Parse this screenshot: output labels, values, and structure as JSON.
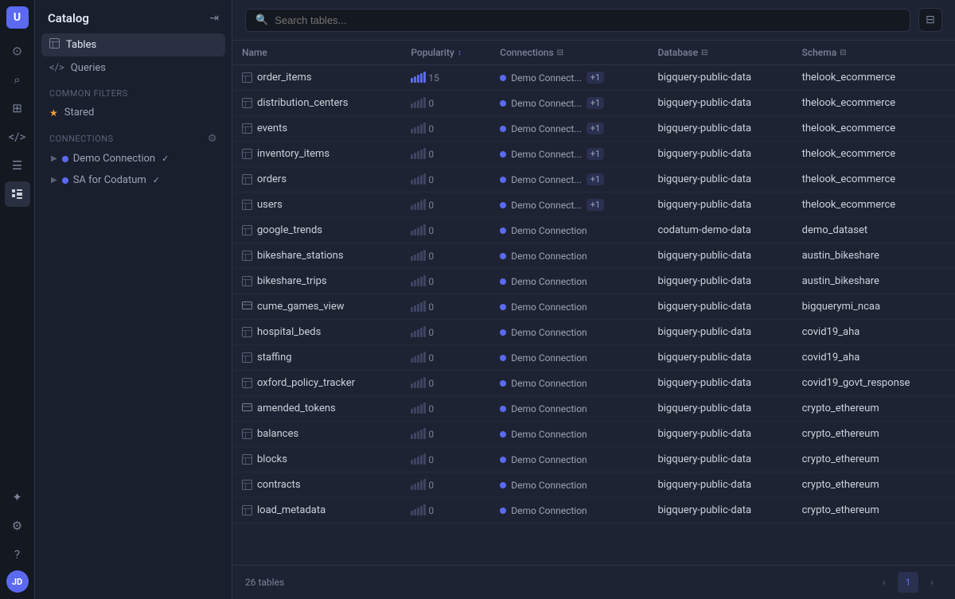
{
  "app": {
    "logo": "U",
    "sidebar_title": "Catalog",
    "collapse_label": "Collapse"
  },
  "sidebar": {
    "nav_items": [
      {
        "id": "home",
        "icon": "⊙",
        "label": "Home"
      },
      {
        "id": "search",
        "icon": "⌕",
        "label": "Search"
      },
      {
        "id": "explore",
        "icon": "⊞",
        "label": "Explore"
      },
      {
        "id": "code",
        "icon": "</>",
        "label": "Code"
      },
      {
        "id": "docs",
        "icon": "⊟",
        "label": "Docs"
      },
      {
        "id": "catalog",
        "icon": "☰",
        "label": "Catalog",
        "active": true
      }
    ],
    "bottom_items": [
      {
        "id": "sparkle",
        "icon": "✦",
        "label": "AI"
      },
      {
        "id": "settings",
        "icon": "⚙",
        "label": "Settings"
      },
      {
        "id": "help",
        "icon": "?",
        "label": "Help"
      }
    ],
    "avatar_initials": "JD",
    "common_filters_label": "Common filters",
    "stared_label": "Stared",
    "connections_label": "Connections",
    "connections": [
      {
        "id": "demo",
        "name": "Demo Connection",
        "check": true
      },
      {
        "id": "sa",
        "name": "SA for Codatum",
        "check": true
      }
    ]
  },
  "search": {
    "placeholder": "Search tables..."
  },
  "table": {
    "columns": [
      {
        "id": "name",
        "label": "Name",
        "sort": false,
        "filter": false
      },
      {
        "id": "popularity",
        "label": "Popularity",
        "sort": true,
        "filter": false
      },
      {
        "id": "connections",
        "label": "Connections",
        "sort": false,
        "filter": true
      },
      {
        "id": "database",
        "label": "Database",
        "sort": false,
        "filter": true
      },
      {
        "id": "schema",
        "label": "Schema",
        "sort": false,
        "filter": true
      }
    ],
    "rows": [
      {
        "name": "order_items",
        "type": "table",
        "popularity": 15,
        "pop_bars": [
          1,
          1,
          1,
          1,
          1
        ],
        "connection": "Demo Connect...",
        "plus": "+1",
        "database": "bigquery-public-data",
        "schema": "thelook_ecommerce"
      },
      {
        "name": "distribution_centers",
        "type": "table",
        "popularity": 0,
        "pop_bars": [
          0,
          0,
          0,
          0,
          0
        ],
        "connection": "Demo Connect...",
        "plus": "+1",
        "database": "bigquery-public-data",
        "schema": "thelook_ecommerce"
      },
      {
        "name": "events",
        "type": "table",
        "popularity": 0,
        "pop_bars": [
          0,
          0,
          0,
          0,
          0
        ],
        "connection": "Demo Connect...",
        "plus": "+1",
        "database": "bigquery-public-data",
        "schema": "thelook_ecommerce"
      },
      {
        "name": "inventory_items",
        "type": "table",
        "popularity": 0,
        "pop_bars": [
          0,
          0,
          0,
          0,
          0
        ],
        "connection": "Demo Connect...",
        "plus": "+1",
        "database": "bigquery-public-data",
        "schema": "thelook_ecommerce"
      },
      {
        "name": "orders",
        "type": "table",
        "popularity": 0,
        "pop_bars": [
          0,
          0,
          0,
          0,
          0
        ],
        "connection": "Demo Connect...",
        "plus": "+1",
        "database": "bigquery-public-data",
        "schema": "thelook_ecommerce"
      },
      {
        "name": "users",
        "type": "table",
        "popularity": 0,
        "pop_bars": [
          0,
          0,
          0,
          0,
          0
        ],
        "connection": "Demo Connect...",
        "plus": "+1",
        "database": "bigquery-public-data",
        "schema": "thelook_ecommerce"
      },
      {
        "name": "google_trends",
        "type": "table",
        "popularity": 0,
        "pop_bars": [
          0,
          0,
          0,
          0,
          0
        ],
        "connection": "Demo Connection",
        "plus": null,
        "database": "codatum-demo-data",
        "schema": "demo_dataset"
      },
      {
        "name": "bikeshare_stations",
        "type": "table",
        "popularity": 0,
        "pop_bars": [
          0,
          0,
          0,
          0,
          0
        ],
        "connection": "Demo Connection",
        "plus": null,
        "database": "bigquery-public-data",
        "schema": "austin_bikeshare"
      },
      {
        "name": "bikeshare_trips",
        "type": "table",
        "popularity": 0,
        "pop_bars": [
          0,
          0,
          0,
          0,
          0
        ],
        "connection": "Demo Connection",
        "plus": null,
        "database": "bigquery-public-data",
        "schema": "austin_bikeshare"
      },
      {
        "name": "cume_games_view",
        "type": "view",
        "popularity": 0,
        "pop_bars": [
          0,
          0,
          0,
          0,
          0
        ],
        "connection": "Demo Connection",
        "plus": null,
        "database": "bigquery-public-data",
        "schema": "bigquerymi_ncaa"
      },
      {
        "name": "hospital_beds",
        "type": "table",
        "popularity": 0,
        "pop_bars": [
          0,
          0,
          0,
          0,
          0
        ],
        "connection": "Demo Connection",
        "plus": null,
        "database": "bigquery-public-data",
        "schema": "covid19_aha"
      },
      {
        "name": "staffing",
        "type": "table",
        "popularity": 0,
        "pop_bars": [
          0,
          0,
          0,
          0,
          0
        ],
        "connection": "Demo Connection",
        "plus": null,
        "database": "bigquery-public-data",
        "schema": "covid19_aha"
      },
      {
        "name": "oxford_policy_tracker",
        "type": "table",
        "popularity": 0,
        "pop_bars": [
          0,
          0,
          0,
          0,
          0
        ],
        "connection": "Demo Connection",
        "plus": null,
        "database": "bigquery-public-data",
        "schema": "covid19_govt_response"
      },
      {
        "name": "amended_tokens",
        "type": "view",
        "popularity": 0,
        "pop_bars": [
          0,
          0,
          0,
          0,
          0
        ],
        "connection": "Demo Connection",
        "plus": null,
        "database": "bigquery-public-data",
        "schema": "crypto_ethereum"
      },
      {
        "name": "balances",
        "type": "table",
        "popularity": 0,
        "pop_bars": [
          0,
          0,
          0,
          0,
          0
        ],
        "connection": "Demo Connection",
        "plus": null,
        "database": "bigquery-public-data",
        "schema": "crypto_ethereum"
      },
      {
        "name": "blocks",
        "type": "table",
        "popularity": 0,
        "pop_bars": [
          0,
          0,
          0,
          0,
          0
        ],
        "connection": "Demo Connection",
        "plus": null,
        "database": "bigquery-public-data",
        "schema": "crypto_ethereum"
      },
      {
        "name": "contracts",
        "type": "table",
        "popularity": 0,
        "pop_bars": [
          0,
          0,
          0,
          0,
          0
        ],
        "connection": "Demo Connection",
        "plus": null,
        "database": "bigquery-public-data",
        "schema": "crypto_ethereum"
      },
      {
        "name": "load_metadata",
        "type": "table",
        "popularity": 0,
        "pop_bars": [
          0,
          0,
          0,
          0,
          0
        ],
        "connection": "Demo Connection",
        "plus": null,
        "database": "bigquery-public-data",
        "schema": "crypto_ethereum"
      }
    ],
    "total_count": "26 tables",
    "current_page": 1
  }
}
